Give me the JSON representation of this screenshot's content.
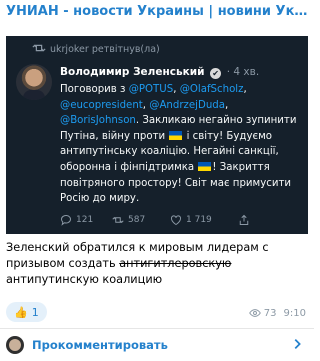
{
  "channel": {
    "title": "УНИАН - новости Украины | новини Украї..."
  },
  "tweet": {
    "retweet_text": "ukrjoker ретвітнув(ла)",
    "author": "Володимир Зеленський",
    "time": "· 4 хв.",
    "text_parts": {
      "p1": "Поговорив з ",
      "m1": "@POTUS",
      "p2": ", ",
      "m2": "@OlafScholz",
      "p3": ",",
      "m3": "@eucopresident",
      "p4": ", ",
      "m4": "@AndrzejDuda",
      "p5": ",",
      "m5": "@BorisJohnson",
      "p6": ". Закликаю негайно зупинити Путіна, війну проти ",
      "p7": " і світу! Будуємо антипутінську коаліцію. Негайні санкції, оборонна і фінпідтримка ",
      "p8": "! Закриття повітряного простору! Світ має примусити Росію до миру."
    },
    "stats": {
      "replies": "121",
      "retweets": "587",
      "likes": "1 719"
    }
  },
  "message": {
    "text_before": "Зеленский обратился к мировым лидерам с призывом создать ",
    "strikethrough": "антигитлеровскую",
    "text_after": " антипутинскую коалицию"
  },
  "reaction": {
    "emoji": "👍",
    "count": "1"
  },
  "views": {
    "count": "73",
    "time": "9:10"
  },
  "comment": {
    "label": "Прокомментировать"
  },
  "colors": {
    "accent": "#2481cc",
    "tweet_bg": "#15202b",
    "mention": "#1d9bf0"
  }
}
